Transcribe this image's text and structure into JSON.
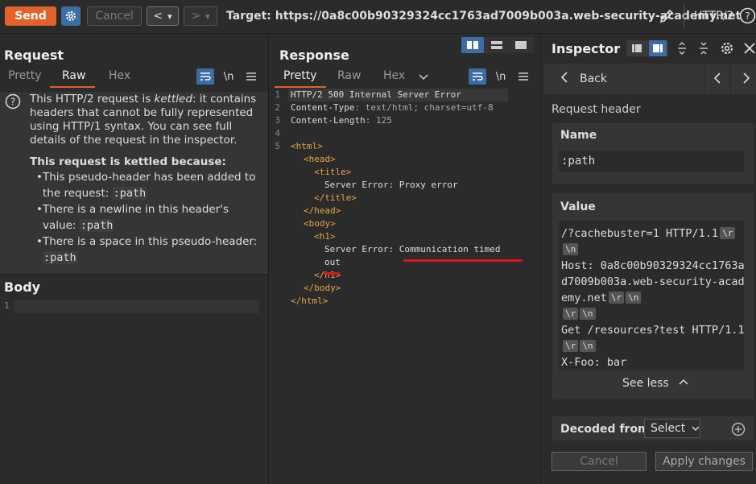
{
  "toolbar": {
    "send_label": "Send",
    "cancel_label": "Cancel",
    "back_label": "<",
    "forward_label": ">",
    "dropdown": "▾",
    "target": "Target: https://0a8c00b90329324cc1763ad7009b003a.web-security-academy.net",
    "protocol": "HTTP/2",
    "help": "?"
  },
  "request": {
    "title": "Request",
    "tabs": [
      "Pretty",
      "Raw",
      "Hex"
    ],
    "newline_label": "\\n",
    "kettled": {
      "intro_pre": "This HTTP/2 request is ",
      "intro_em": "kettled",
      "intro_rest": ": it contains headers that cannot be fully represented using HTTP/1 syntax. You can see full details of the request in the inspector.",
      "heading": "This request is kettled because:",
      "bullets": [
        {
          "text": "This pseudo-header has been added to the request: ",
          "code": ":path"
        },
        {
          "text": "There is a newline in this header's value: ",
          "code": ":path"
        },
        {
          "text": "There is a space in this pseudo-header: ",
          "code": ":path"
        }
      ]
    },
    "body_title": "Body",
    "body_line_number": "1"
  },
  "response": {
    "title": "Response",
    "tabs": [
      "Pretty",
      "Raw",
      "Hex"
    ],
    "newline_label": "\\n",
    "lines": [
      {
        "n": "1",
        "text": "HTTP/2 500 Internal Server Error"
      },
      {
        "n": "2",
        "key": "Content-Type",
        "val": ": text/html; charset=utf-8"
      },
      {
        "n": "3",
        "key": "Content-Length",
        "val": ": 125"
      },
      {
        "n": "4",
        "text": ""
      },
      {
        "n": "5",
        "text": "<html>"
      },
      {
        "n": "",
        "text": "<head>"
      },
      {
        "n": "",
        "text": "<title>"
      },
      {
        "n": "",
        "text": "Server Error: Proxy error"
      },
      {
        "n": "",
        "text": "</title>"
      },
      {
        "n": "",
        "text": "</head>"
      },
      {
        "n": "",
        "text": "<body>"
      },
      {
        "n": "",
        "text": "<h1>"
      },
      {
        "n": "",
        "text": "Server Error: Communication timed"
      },
      {
        "n": "",
        "text": "out"
      },
      {
        "n": "",
        "text": "</h1>"
      },
      {
        "n": "",
        "text": "</body>"
      },
      {
        "n": "",
        "text": "</html>"
      }
    ]
  },
  "inspector": {
    "title": "Inspector",
    "back_label": "Back",
    "section": "Request header",
    "name_label": "Name",
    "name_value": ":path",
    "value_label": "Value",
    "value_lines": [
      {
        "text": "/?cachebuster=1 HTTP/1.1",
        "esc": [
          "\\r"
        ]
      },
      {
        "text": "",
        "esc": [
          "\\n"
        ]
      },
      {
        "text": "Host: 0a8c00b90329324cc1763a",
        "esc": []
      },
      {
        "text": "d7009b003a.web-security-acad",
        "esc": []
      },
      {
        "text": "emy.net",
        "esc": [
          "\\r",
          "\\n"
        ]
      },
      {
        "text": "",
        "esc": [
          "\\r",
          "\\n"
        ]
      },
      {
        "text": "Get /resources?test HTTP/1.1",
        "esc": []
      },
      {
        "text": "",
        "esc": [
          "\\r",
          "\\n"
        ]
      },
      {
        "text": "X-Foo: bar",
        "esc": []
      }
    ],
    "see_less": "See less",
    "decoded_label": "Decoded from:",
    "select_label": "Select",
    "cancel_label": "Cancel",
    "apply_label": "Apply changes"
  },
  "colors": {
    "accent": "#e2622a",
    "blue": "#3a6ea5",
    "underline": "#e0141e"
  }
}
